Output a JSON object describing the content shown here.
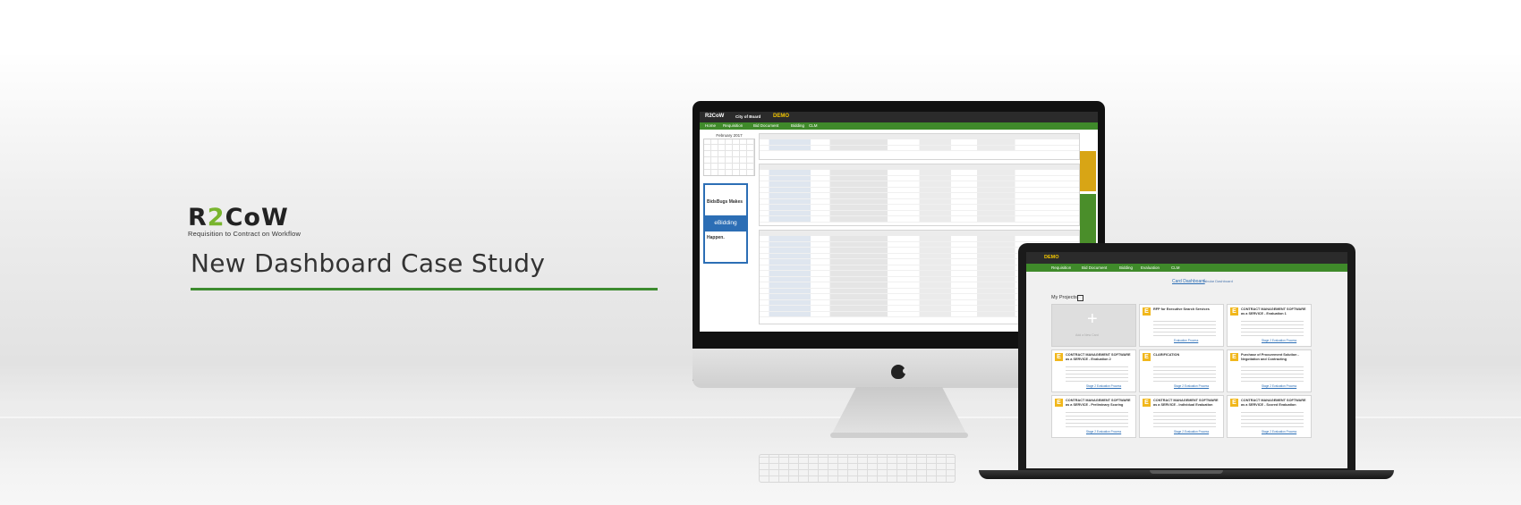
{
  "brand": {
    "logo": {
      "part1": "R",
      "part2": "2",
      "part3": "CoW"
    },
    "tagline": "Requisition to Contract on Workflow",
    "headline": "New Dashboard Case Study",
    "accent": "#3d8b2f"
  },
  "desktop_app": {
    "logo": "R2CoW",
    "org": "City of Board",
    "badge": "DEMO",
    "nav": [
      "Home",
      "Requisition",
      "Bid Document",
      "Bidding",
      "CLM"
    ],
    "calendar_title": "February 2017",
    "ad_text_top": "BidsBugs Makes",
    "ad_text_mid": "eBidding",
    "ad_text_bottom": "Happen."
  },
  "laptop_app": {
    "badge": "DEMO",
    "nav": [
      "Requisition",
      "Bid Document",
      "Bidding",
      "Evaluation",
      "CLM"
    ],
    "tab_active": "Card Dashboard",
    "tab_other": "Tabular Dashboard",
    "section_title": "My Projects",
    "add_card_label": "Add a New Card",
    "cards": [
      {
        "title": "RFP for Executive Search Services",
        "link": "Evaluation Process"
      },
      {
        "title": "CONTRACT MANAGEMENT SOFTWARE as a SERVICE - Evaluation 1",
        "link": "Stage 2 Evaluation Process"
      },
      {
        "title": "CONTRACT MANAGEMENT SOFTWARE as a SERVICE - Evaluation 2",
        "link": "Stage 2 Evaluation Process"
      },
      {
        "title": "CLARIFICATION",
        "link": "Stage 2 Evaluation Process"
      },
      {
        "title": "Purchase of Procurement Solution - Negotiation and Contracting",
        "link": "Stage 2 Evaluation Process"
      },
      {
        "title": "CONTRACT MANAGEMENT SOFTWARE as a SERVICE - Preliminary Scoring",
        "link": "Stage 2 Evaluation Process"
      },
      {
        "title": "CONTRACT MANAGEMENT SOFTWARE as a SERVICE - Individual Evaluation",
        "link": "Stage 2 Evaluation Process"
      },
      {
        "title": "CONTRACT MANAGEMENT SOFTWARE as a SERVICE - Scored Evaluation",
        "link": "Stage 2 Evaluation Process"
      }
    ]
  }
}
